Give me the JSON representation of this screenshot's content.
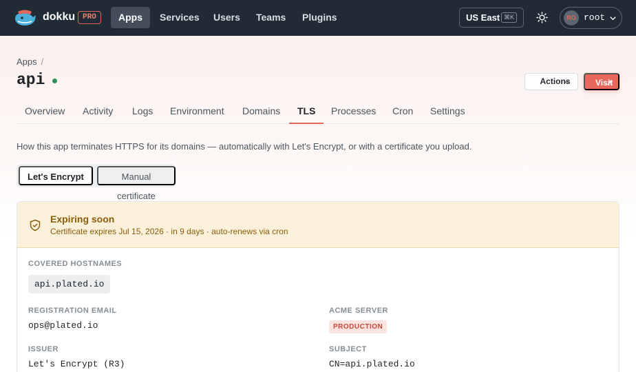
{
  "nav": {
    "brand": "dokku",
    "badge": "PRO",
    "items": [
      {
        "label": "Apps",
        "active": true
      },
      {
        "label": "Services"
      },
      {
        "label": "Users"
      },
      {
        "label": "Teams"
      },
      {
        "label": "Plugins"
      }
    ],
    "region": "US East",
    "region_shortcut": "⌘K",
    "user_initials": "RO",
    "username": "root"
  },
  "page": {
    "breadcrumb": "Apps",
    "breadcrumb_sep": "/",
    "title": "api",
    "actions_label": "Actions",
    "visit_label": "Visit",
    "tabs": [
      {
        "label": "Overview"
      },
      {
        "label": "Activity"
      },
      {
        "label": "Logs"
      },
      {
        "label": "Environment"
      },
      {
        "label": "Domains"
      },
      {
        "label": "TLS",
        "active": true
      },
      {
        "label": "Processes"
      },
      {
        "label": "Cron"
      },
      {
        "label": "Settings"
      }
    ],
    "intro": "How this app terminates HTTPS for its domains — automatically with Let's Encrypt, or with a certificate you upload."
  },
  "tls": {
    "modes": [
      "Let's Encrypt",
      "Manual certificate"
    ],
    "active_mode": "Let's Encrypt",
    "banner": {
      "title": "Expiring soon",
      "subtitle": "Certificate expires Jul 15, 2026 · in 9 days · auto-renews via cron"
    },
    "covered_hostnames_label": "COVERED HOSTNAMES",
    "hostnames": [
      "api.plated.io"
    ],
    "registration_email_label": "REGISTRATION EMAIL",
    "registration_email": "ops@plated.io",
    "acme_server_label": "ACME SERVER",
    "acme_server": "PRODUCTION",
    "issuer_label": "ISSUER",
    "issuer": "Let's Encrypt (R3)",
    "subject_label": "SUBJECT",
    "subject": "CN=api.plated.io"
  },
  "colors": {
    "nav_bg": "#212b36",
    "accent": "#e9675b",
    "warning_bg": "#fbf0d9",
    "warning_text": "#8a5d0c",
    "status_ok": "#2f8f5b"
  }
}
